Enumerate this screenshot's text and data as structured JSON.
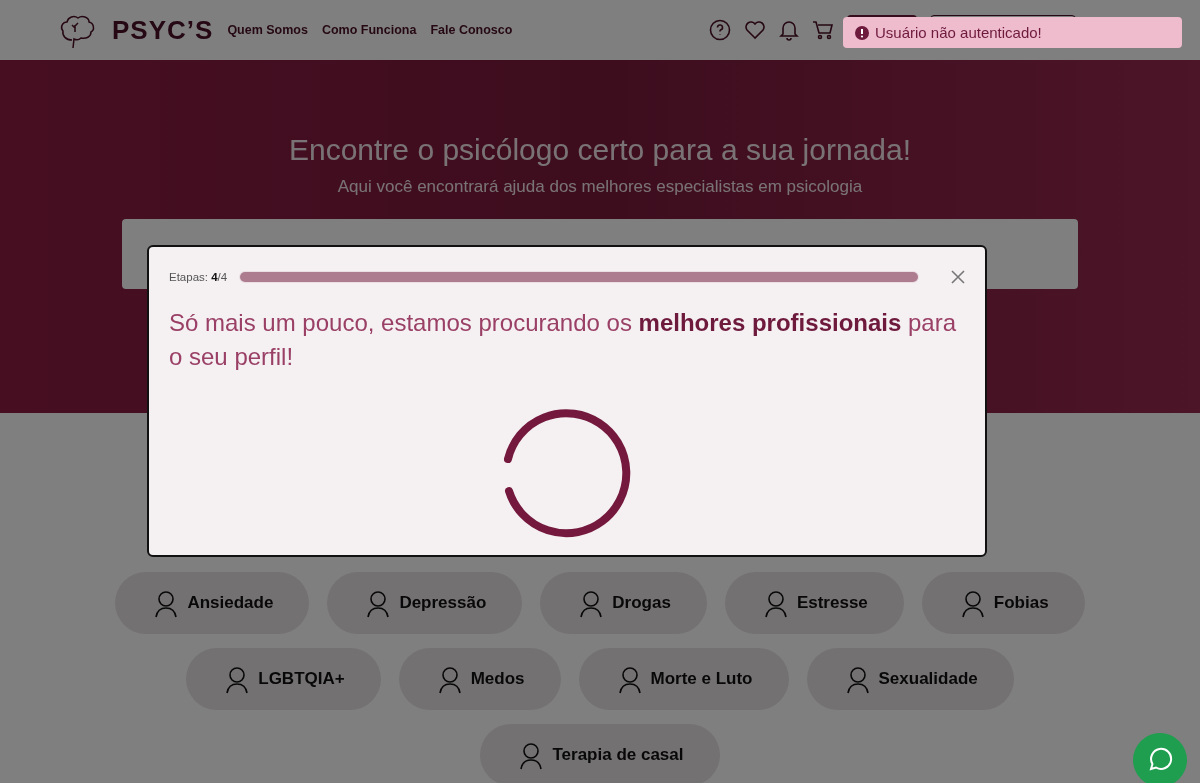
{
  "header": {
    "logo": "PSYC’S",
    "nav": [
      {
        "label": "Quem Somos"
      },
      {
        "label": "Como Funciona"
      },
      {
        "label": "Fale Conosco"
      }
    ]
  },
  "toast": {
    "message": "Usuário não autenticado!"
  },
  "hero": {
    "title": "Encontre o psicólogo certo para a sua jornada!",
    "subtitle": "Aqui você encontrará ajuda dos melhores especialistas em psicologia"
  },
  "modal": {
    "steps": "Etapas: **4**/4",
    "progress": {
      "level": 1
    },
    "message": "Só mais um pouco, estamos procurando os **melhores profissionais** para o seu perfil!"
  },
  "topics": [
    {
      "label": "Ansiedade"
    },
    {
      "label": "Depressão"
    },
    {
      "label": "Drogas"
    },
    {
      "label": "Estresse"
    },
    {
      "label": "Fobias"
    },
    {
      "label": "LGBTQIA+"
    },
    {
      "label": "Medos"
    },
    {
      "label": "Morte e Luto"
    },
    {
      "label": "Sexualidade"
    },
    {
      "label": "Terapia de casal"
    }
  ]
}
